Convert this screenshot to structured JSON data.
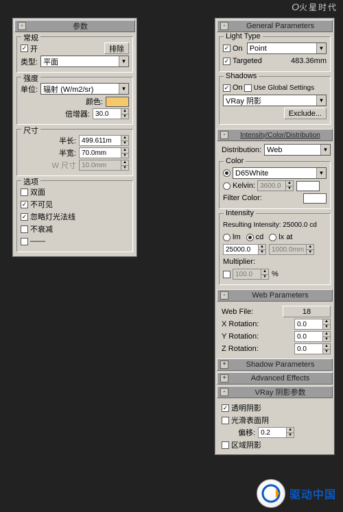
{
  "watermark_top": {
    "italic": "O",
    "brand": "火星时代"
  },
  "watermark_bottom": {
    "text": "驱动中国"
  },
  "left": {
    "header": "参数",
    "general": {
      "legend": "常规",
      "on_label": "开",
      "exclude": "排除",
      "type_label": "类型:",
      "type_value": "平面"
    },
    "intensity": {
      "legend": "强度",
      "unit_label": "单位:",
      "unit_value": "辐射 (W/m2/sr)",
      "color_label": "颜色:",
      "multiplier_label": "倍增器:",
      "multiplier_value": "30.0"
    },
    "size": {
      "legend": "尺寸",
      "half_len_label": "半长:",
      "half_len_value": "499.611m",
      "half_wid_label": "半宽:",
      "half_wid_value": "70.0mm",
      "w_size_label": "W 尺寸",
      "w_size_value": "10.0mm"
    },
    "options": {
      "legend": "选项",
      "double_sided": "双面",
      "invisible": "不可见",
      "ignore_norm": "忽略灯光法线",
      "no_decay": "不衰减"
    }
  },
  "right": {
    "general_header": "General Parameters",
    "light_type": {
      "legend": "Light Type",
      "on": "On",
      "type_value": "Point",
      "targeted": "Targeted",
      "target_dist": "483.36mm"
    },
    "shadows": {
      "legend": "Shadows",
      "on": "On",
      "use_global": "Use Global Settings",
      "generator": "VRay 阴影",
      "exclude": "Exclude..."
    },
    "icd_header": "Intensity/Color/Distribution",
    "distribution_label": "Distribution:",
    "distribution_value": "Web",
    "color": {
      "legend": "Color",
      "preset": "D65White",
      "kelvin_label": "Kelvin:",
      "kelvin_value": "3600.0",
      "filter_label": "Filter Color:"
    },
    "intensity": {
      "legend": "Intensity",
      "resulting": "Resulting Intensity: 25000.0 cd",
      "lm": "lm",
      "cd": "cd",
      "lx": "lx at",
      "val1": "25000.0",
      "val2": "1000.0mm",
      "multiplier_label": "Multiplier:",
      "multiplier_value": "100.0",
      "pct": "%"
    },
    "web_header": "Web Parameters",
    "web_file_label": "Web File:",
    "web_file_value": "18",
    "xrot_label": "X Rotation:",
    "xrot_val": "0.0",
    "yrot_label": "Y Rotation:",
    "yrot_val": "0.0",
    "zrot_label": "Z Rotation:",
    "zrot_val": "0.0",
    "shadow_params_header": "Shadow Parameters",
    "advanced_header": "Advanced Effects",
    "vray_header": "VRay 阴影参数",
    "vray": {
      "transparent": "透明阴影",
      "smooth": "光滑表面阴",
      "bias_label": "偏移:",
      "bias_value": "0.2",
      "area": "区域阴影"
    }
  }
}
